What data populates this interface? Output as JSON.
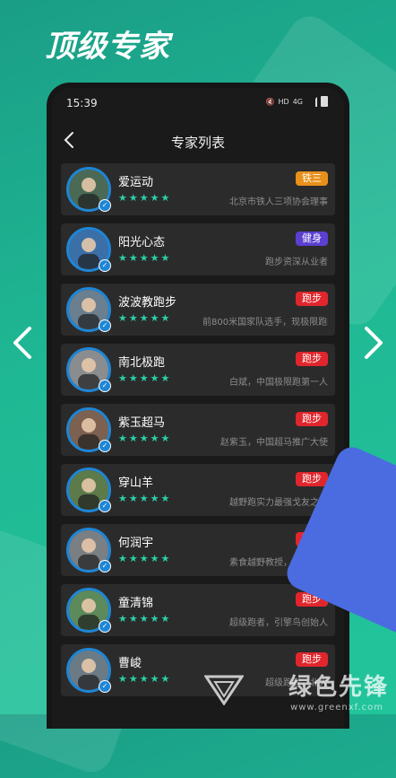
{
  "promo": {
    "title": "顶级专家"
  },
  "status_bar": {
    "time": "15:39",
    "icons": [
      "mute-icon",
      "hd-icon",
      "4g-signal-icon",
      "wifi-signal-icon",
      "battery-icon"
    ]
  },
  "header": {
    "title": "专家列表"
  },
  "experts": [
    {
      "name": "爱运动",
      "tag": "铁三",
      "tag_color": "#e8901a",
      "desc": "北京市铁人三项协会理事",
      "stars": "★★★★★"
    },
    {
      "name": "阳光心态",
      "tag": "健身",
      "tag_color": "#5b3fd0",
      "desc": "跑步资深从业者",
      "stars": "★★★★★"
    },
    {
      "name": "波波教跑步",
      "tag": "跑步",
      "tag_color": "#e0262c",
      "desc": "前800米国家队选手，现极限跑者",
      "stars": "★★★★★"
    },
    {
      "name": "南北极跑",
      "tag": "跑步",
      "tag_color": "#e0262c",
      "desc": "白斌，中国极限跑第一人",
      "stars": "★★★★★"
    },
    {
      "name": "紫玉超马",
      "tag": "跑步",
      "tag_color": "#e0262c",
      "desc": "赵紫玉，中国超马推广大使",
      "stars": "★★★★★"
    },
    {
      "name": "穿山羊",
      "tag": "跑步",
      "tag_color": "#e0262c",
      "desc": "越野跑实力最强戈友之一",
      "stars": "★★★★★"
    },
    {
      "name": "何润宇",
      "tag": "跑步",
      "tag_color": "#e0262c",
      "desc": "素食越野教授，超级跑者",
      "stars": "★★★★★"
    },
    {
      "name": "童清锦",
      "tag": "跑步",
      "tag_color": "#e0262c",
      "desc": "超级跑者，引擎鸟创始人",
      "stars": "★★★★★"
    },
    {
      "name": "曹峻",
      "tag": "跑步",
      "tag_color": "#e0262c",
      "desc": "超级跑者，北大",
      "stars": "★★★★★"
    }
  ],
  "watermark": {
    "text": "绿色先锋",
    "url": "www.greenxf.com"
  },
  "colors": {
    "accent": "#2ad1a9",
    "background": "#1fb894",
    "avatar_ring": "#1e86d6"
  }
}
